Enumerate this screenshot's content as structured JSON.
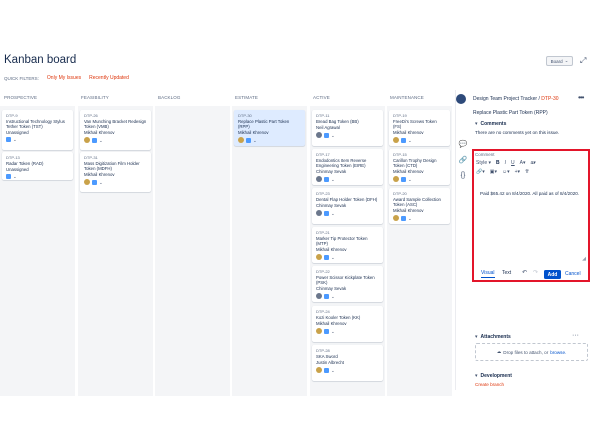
{
  "header": {
    "title": "Kanban board",
    "quick_filters_label": "QUICK FILTERS:",
    "filters": [
      "Only My Issues",
      "Recently Updated"
    ],
    "board_button": "Board",
    "expand_icon": "expand-icon"
  },
  "columns": [
    {
      "name": "PROSPECTIVE",
      "cards": [
        {
          "key": "DTP-9",
          "title": "Instructional Technology Stylus Tether Token (TST)",
          "assignee": "Unassigned"
        },
        {
          "key": "DTP-13",
          "title": "Radar Token (RAD)",
          "assignee": "Unassigned"
        }
      ]
    },
    {
      "name": "FEASIBILITY",
      "cards": [
        {
          "key": "DTP-26",
          "title": "Van Munching Bracket Redesign Token (VMB)",
          "assignee": "Mikhail Khrenov"
        },
        {
          "key": "DTP-31",
          "title": "Mass Digitization Film Holder Token (MDFH)",
          "assignee": "Mikhail Khrenov"
        }
      ]
    },
    {
      "name": "BACKLOG",
      "cards": []
    },
    {
      "name": "ESTIMATE",
      "cards": [
        {
          "key": "DTP-30",
          "title": "Replace Plastic Part Token (RPP)",
          "assignee": "Mikhail Khrenov"
        }
      ]
    },
    {
      "name": "ACTIVE",
      "cards": [
        {
          "key": "DTP-11",
          "title": "Bread Bag Token (BB)",
          "assignee": "Neil Agrawal"
        },
        {
          "key": "DTP-17",
          "title": "Endodontics Item Reverse Engineering Token (EIRE)",
          "assignee": "Chinmay Sevak"
        },
        {
          "key": "DTP-23",
          "title": "Dental Flap Holder Token (DFH)",
          "assignee": "Chinmay Sevak"
        },
        {
          "key": "DTP-21",
          "title": "Marker Tip Protector Token (MTP)",
          "assignee": "Mikhail Khrenov"
        },
        {
          "key": "DTP-22",
          "title": "Power Scissor Kickplate Token (PSK)",
          "assignee": "Chinmay Sevak"
        },
        {
          "key": "DTP-24",
          "title": "Kozi Kooler Token (KK)",
          "assignee": "Mikhail Khrenov"
        },
        {
          "key": "DTP-28",
          "title": "SKA Sword",
          "assignee": "Justin Albrecht"
        }
      ]
    },
    {
      "name": "MAINTENANCE",
      "cards": [
        {
          "key": "DTP-19",
          "title": "FreeDi's Screws Token (FS)",
          "assignee": "Mikhail Khrenov"
        },
        {
          "key": "DTP-15",
          "title": "Carillon Trophy Design Token (CTD)",
          "assignee": "Mikhail Khrenov"
        },
        {
          "key": "DTP-20",
          "title": "Award Sample Collection Token (ASC)",
          "assignee": "Mikhail Khrenov"
        }
      ]
    }
  ],
  "panel": {
    "project": "Design Team Project Tracker",
    "separator": " / ",
    "issue_key": "DTP-30",
    "issue_title": "Replace Plastic Part Token (RPP)",
    "comments_heading": "Comments",
    "no_comments": "There are no comments yet on this issue.",
    "comment_label": "Comment",
    "toolbar_style": "Style",
    "comment_text": "Paid $65.42 on 8/4/2020. All paid as of 8/4/2020.",
    "tab_visual": "Visual",
    "tab_text": "Text",
    "add_label": "Add",
    "cancel_label": "Cancel",
    "attachments_heading": "Attachments",
    "drop_text": "Drop files to attach, or",
    "browse": "browse.",
    "development_heading": "Development",
    "create_branch": "Create branch"
  }
}
